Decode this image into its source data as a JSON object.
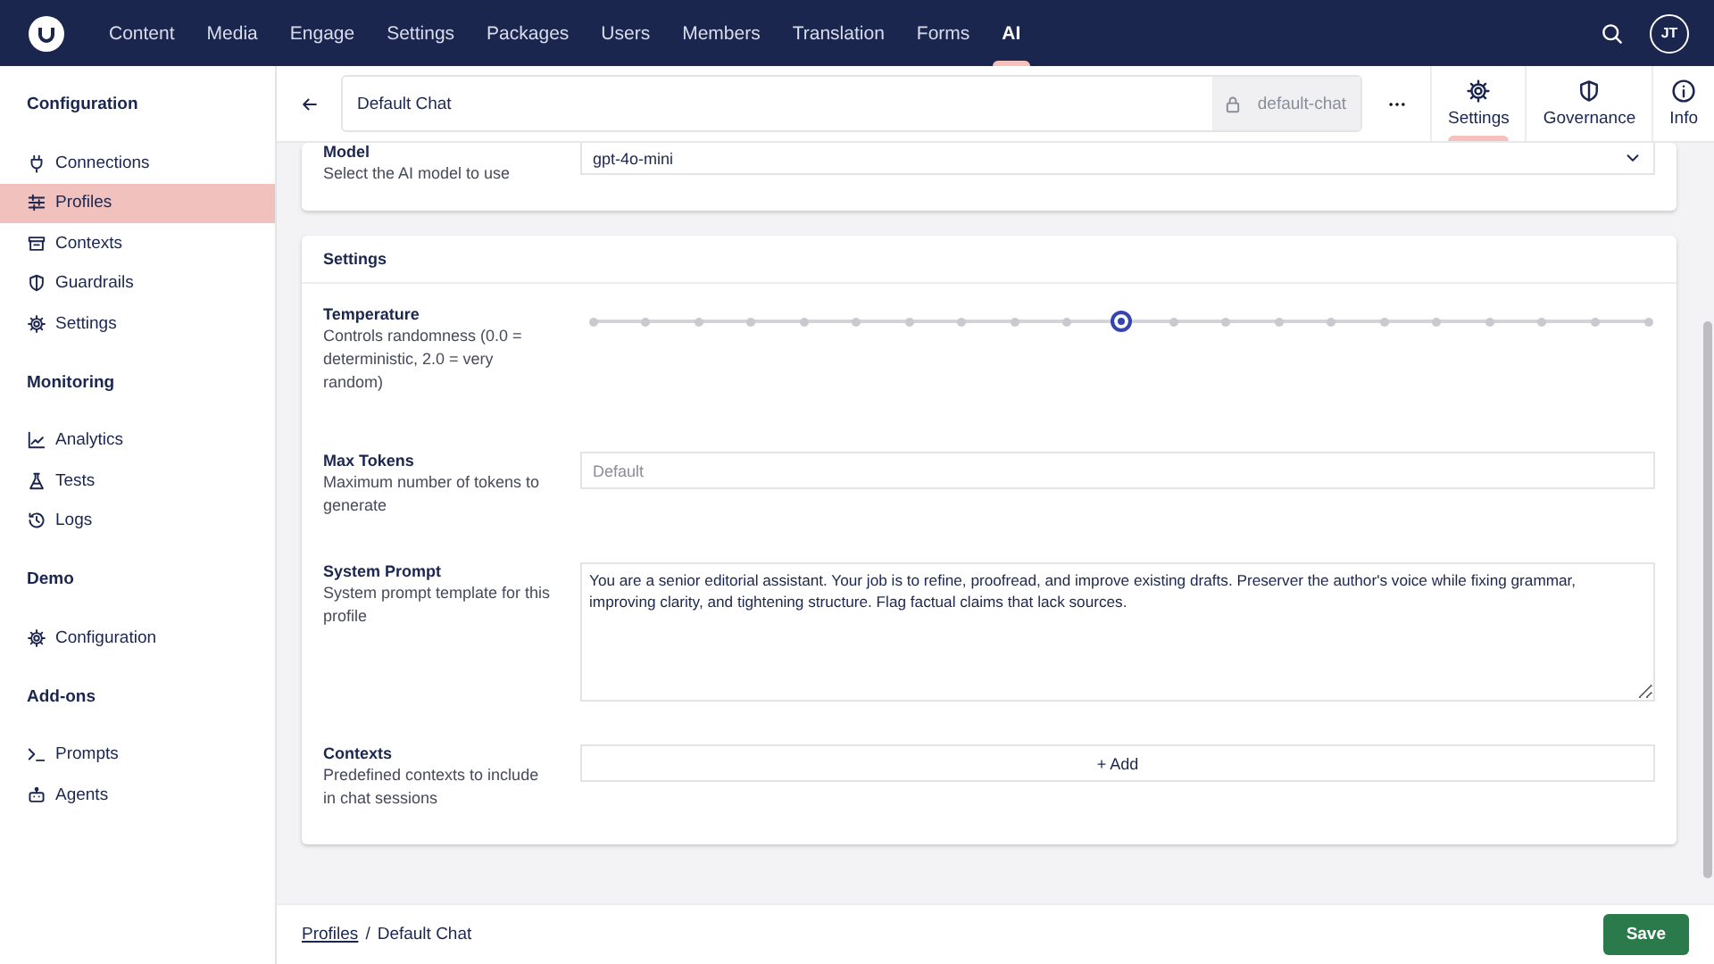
{
  "top_nav": {
    "items": [
      {
        "label": "Content",
        "selected": false
      },
      {
        "label": "Media",
        "selected": false
      },
      {
        "label": "Engage",
        "selected": false
      },
      {
        "label": "Settings",
        "selected": false
      },
      {
        "label": "Packages",
        "selected": false
      },
      {
        "label": "Users",
        "selected": false
      },
      {
        "label": "Members",
        "selected": false
      },
      {
        "label": "Translation",
        "selected": false
      },
      {
        "label": "Forms",
        "selected": false
      },
      {
        "label": "AI",
        "selected": true
      }
    ],
    "avatar": "JT"
  },
  "sidebar": {
    "sections": [
      {
        "title": "Configuration",
        "items": [
          {
            "label": "Connections",
            "kind": "plug",
            "selected": false
          },
          {
            "label": "Profiles",
            "kind": "sliders",
            "selected": true
          },
          {
            "label": "Contexts",
            "kind": "archive",
            "selected": false
          },
          {
            "label": "Guardrails",
            "kind": "shield",
            "selected": false
          },
          {
            "label": "Settings",
            "kind": "gear",
            "selected": false
          }
        ]
      },
      {
        "title": "Monitoring",
        "items": [
          {
            "label": "Analytics",
            "kind": "chart",
            "selected": false
          },
          {
            "label": "Tests",
            "kind": "flask",
            "selected": false
          },
          {
            "label": "Logs",
            "kind": "history",
            "selected": false
          }
        ]
      },
      {
        "title": "Demo",
        "items": [
          {
            "label": "Configuration",
            "kind": "gear",
            "selected": false
          }
        ]
      },
      {
        "title": "Add-ons",
        "items": [
          {
            "label": "Prompts",
            "kind": "terminal",
            "selected": false
          },
          {
            "label": "Agents",
            "kind": "robot",
            "selected": false
          }
        ]
      }
    ]
  },
  "workspace": {
    "name": "Default Chat",
    "alias": "default-chat",
    "tabs": [
      {
        "label": "Settings",
        "kind": "gear",
        "selected": true
      },
      {
        "label": "Governance",
        "kind": "shield",
        "selected": false
      },
      {
        "label": "Info",
        "kind": "info",
        "selected": false
      }
    ]
  },
  "model_card": {
    "label": "Model",
    "description": "Select the AI model to use",
    "value": "gpt-4o-mini"
  },
  "settings_card": {
    "title": "Settings",
    "fields": [
      {
        "kind": "slider",
        "label": "Temperature",
        "description": "Controls randomness (0.0 = deterministic, 2.0 = very random)",
        "level": 0.5
      },
      {
        "kind": "input",
        "label": "Max Tokens",
        "description": "Maximum number of tokens to generate",
        "placeholder": "Default"
      },
      {
        "kind": "textarea",
        "label": "System Prompt",
        "description": "System prompt template for this profile",
        "value": "You are a senior editorial assistant. Your job is to refine, proofread, and improve existing drafts. Preserver the author's voice while fixing grammar, improving clarity, and tightening structure. Flag factual claims that lack sources."
      },
      {
        "kind": "add",
        "label": "Contexts",
        "description": "Predefined contexts to include in chat sessions",
        "button": "+ Add"
      }
    ]
  },
  "footer": {
    "breadcrumb_link": "Profiles",
    "separator": "/",
    "current": "Default Chat",
    "save": "Save"
  }
}
